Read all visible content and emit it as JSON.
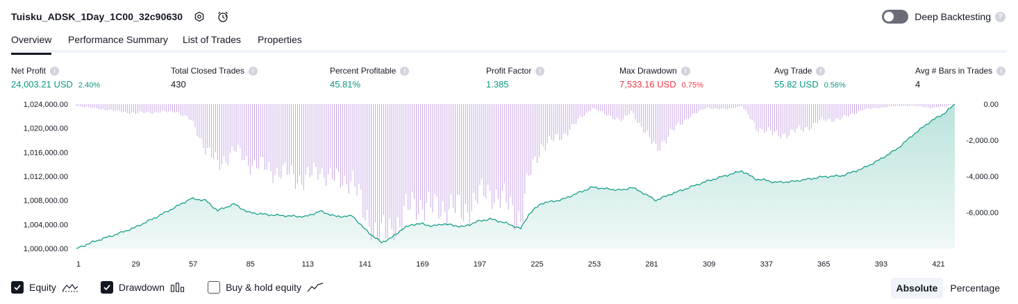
{
  "header": {
    "title": "Tuisku_ADSK_1Day_1C00_32c90630",
    "deep_backtesting_label": "Deep Backtesting",
    "deep_backtesting_on": false,
    "help_glyph": "?"
  },
  "tabs": [
    {
      "label": "Overview",
      "active": true
    },
    {
      "label": "Performance Summary",
      "active": false
    },
    {
      "label": "List of Trades",
      "active": false
    },
    {
      "label": "Properties",
      "active": false
    }
  ],
  "stats": [
    {
      "label": "Net Profit",
      "value": "24,003.21 USD",
      "pct": "2.40%",
      "color": "green"
    },
    {
      "label": "Total Closed Trades",
      "value": "430",
      "pct": "",
      "color": "black"
    },
    {
      "label": "Percent Profitable",
      "value": "45.81%",
      "pct": "",
      "color": "green"
    },
    {
      "label": "Profit Factor",
      "value": "1.385",
      "pct": "",
      "color": "green"
    },
    {
      "label": "Max Drawdown",
      "value": "7,533.16 USD",
      "pct": "0.75%",
      "color": "red"
    },
    {
      "label": "Avg Trade",
      "value": "55.82 USD",
      "pct": "0.56%",
      "color": "green"
    },
    {
      "label": "Avg # Bars in Trades",
      "value": "4",
      "pct": "",
      "color": "black"
    }
  ],
  "info_glyph": "i",
  "chart_data": {
    "type": "area",
    "left_axis": {
      "ticks": [
        1024000,
        1020000,
        1016000,
        1012000,
        1008000,
        1004000,
        1000000
      ],
      "tick_labels": [
        "1,024,000.00",
        "1,020,000.00",
        "1,016,000.00",
        "1,012,000.00",
        "1,008,000.00",
        "1,004,000.00",
        "1,000,000.00"
      ],
      "range": [
        1000000,
        1024000
      ]
    },
    "right_axis": {
      "ticks": [
        0,
        -2000,
        -4000,
        -6000
      ],
      "tick_labels": [
        "0.00",
        "-2,000.00",
        "-4,000.00",
        "-6,000.00"
      ],
      "range": [
        -7533.16,
        0
      ]
    },
    "x_axis": {
      "ticks": [
        1,
        29,
        57,
        85,
        113,
        141,
        169,
        197,
        225,
        253,
        281,
        309,
        337,
        365,
        393,
        421
      ],
      "range": [
        1,
        430
      ]
    },
    "series": [
      {
        "name": "Equity",
        "axis": "left",
        "color": "#089981",
        "points": [
          [
            1,
            1000000
          ],
          [
            10,
            1001200
          ],
          [
            20,
            1002300
          ],
          [
            29,
            1003400
          ],
          [
            40,
            1005200
          ],
          [
            50,
            1007000
          ],
          [
            57,
            1008300
          ],
          [
            64,
            1008000
          ],
          [
            70,
            1006300
          ],
          [
            78,
            1007400
          ],
          [
            85,
            1006000
          ],
          [
            95,
            1005600
          ],
          [
            105,
            1005400
          ],
          [
            113,
            1005300
          ],
          [
            120,
            1006200
          ],
          [
            128,
            1005300
          ],
          [
            136,
            1005400
          ],
          [
            141,
            1003500
          ],
          [
            146,
            1002000
          ],
          [
            150,
            1001000
          ],
          [
            155,
            1001800
          ],
          [
            160,
            1003200
          ],
          [
            165,
            1004000
          ],
          [
            170,
            1004100
          ],
          [
            175,
            1003700
          ],
          [
            180,
            1004100
          ],
          [
            190,
            1003600
          ],
          [
            197,
            1004500
          ],
          [
            203,
            1004900
          ],
          [
            210,
            1004300
          ],
          [
            218,
            1003300
          ],
          [
            222,
            1005700
          ],
          [
            228,
            1007500
          ],
          [
            238,
            1008100
          ],
          [
            248,
            1009500
          ],
          [
            253,
            1010200
          ],
          [
            260,
            1009900
          ],
          [
            268,
            1009700
          ],
          [
            272,
            1010200
          ],
          [
            278,
            1009200
          ],
          [
            284,
            1008000
          ],
          [
            291,
            1009000
          ],
          [
            300,
            1010100
          ],
          [
            309,
            1011200
          ],
          [
            318,
            1012100
          ],
          [
            326,
            1012900
          ],
          [
            333,
            1011500
          ],
          [
            337,
            1011400
          ],
          [
            342,
            1011000
          ],
          [
            350,
            1011100
          ],
          [
            360,
            1011600
          ],
          [
            365,
            1011900
          ],
          [
            375,
            1012100
          ],
          [
            385,
            1013300
          ],
          [
            393,
            1014700
          ],
          [
            402,
            1016600
          ],
          [
            410,
            1019000
          ],
          [
            418,
            1021100
          ],
          [
            425,
            1022500
          ],
          [
            430,
            1024003.21
          ]
        ]
      },
      {
        "name": "Drawdown",
        "axis": "right",
        "color": "#c8a6e6",
        "points": [
          [
            1,
            -100
          ],
          [
            29,
            -500
          ],
          [
            50,
            -400
          ],
          [
            57,
            -900
          ],
          [
            64,
            -2400
          ],
          [
            70,
            -3400
          ],
          [
            78,
            -2500
          ],
          [
            85,
            -3200
          ],
          [
            95,
            -3600
          ],
          [
            105,
            -3900
          ],
          [
            113,
            -4200
          ],
          [
            120,
            -3600
          ],
          [
            128,
            -4300
          ],
          [
            136,
            -4100
          ],
          [
            141,
            -6000
          ],
          [
            146,
            -6900
          ],
          [
            150,
            -7533.16
          ],
          [
            155,
            -7000
          ],
          [
            160,
            -6300
          ],
          [
            165,
            -5600
          ],
          [
            170,
            -5500
          ],
          [
            175,
            -5900
          ],
          [
            180,
            -5600
          ],
          [
            190,
            -6000
          ],
          [
            197,
            -5200
          ],
          [
            203,
            -4800
          ],
          [
            210,
            -5400
          ],
          [
            218,
            -6300
          ],
          [
            222,
            -4100
          ],
          [
            228,
            -2300
          ],
          [
            238,
            -1800
          ],
          [
            248,
            -700
          ],
          [
            253,
            -200
          ],
          [
            260,
            -600
          ],
          [
            268,
            -900
          ],
          [
            272,
            -400
          ],
          [
            278,
            -1400
          ],
          [
            284,
            -2500
          ],
          [
            291,
            -1600
          ],
          [
            300,
            -700
          ],
          [
            309,
            -200
          ],
          [
            318,
            -300
          ],
          [
            326,
            -100
          ],
          [
            333,
            -1300
          ],
          [
            337,
            -1400
          ],
          [
            342,
            -1700
          ],
          [
            350,
            -1600
          ],
          [
            360,
            -1200
          ],
          [
            365,
            -900
          ],
          [
            375,
            -800
          ],
          [
            385,
            -300
          ],
          [
            393,
            -200
          ],
          [
            402,
            -100
          ],
          [
            410,
            -100
          ],
          [
            418,
            -200
          ],
          [
            425,
            -150
          ],
          [
            430,
            0
          ]
        ]
      }
    ]
  },
  "legend": [
    {
      "label": "Equity",
      "checked": true,
      "icon": "equity-line-icon"
    },
    {
      "label": "Drawdown",
      "checked": true,
      "icon": "drawdown-bars-icon"
    },
    {
      "label": "Buy & hold equity",
      "checked": false,
      "icon": "buy-hold-line-icon"
    }
  ],
  "view_toggle": {
    "options": [
      "Absolute",
      "Percentage"
    ],
    "active": "Absolute"
  }
}
